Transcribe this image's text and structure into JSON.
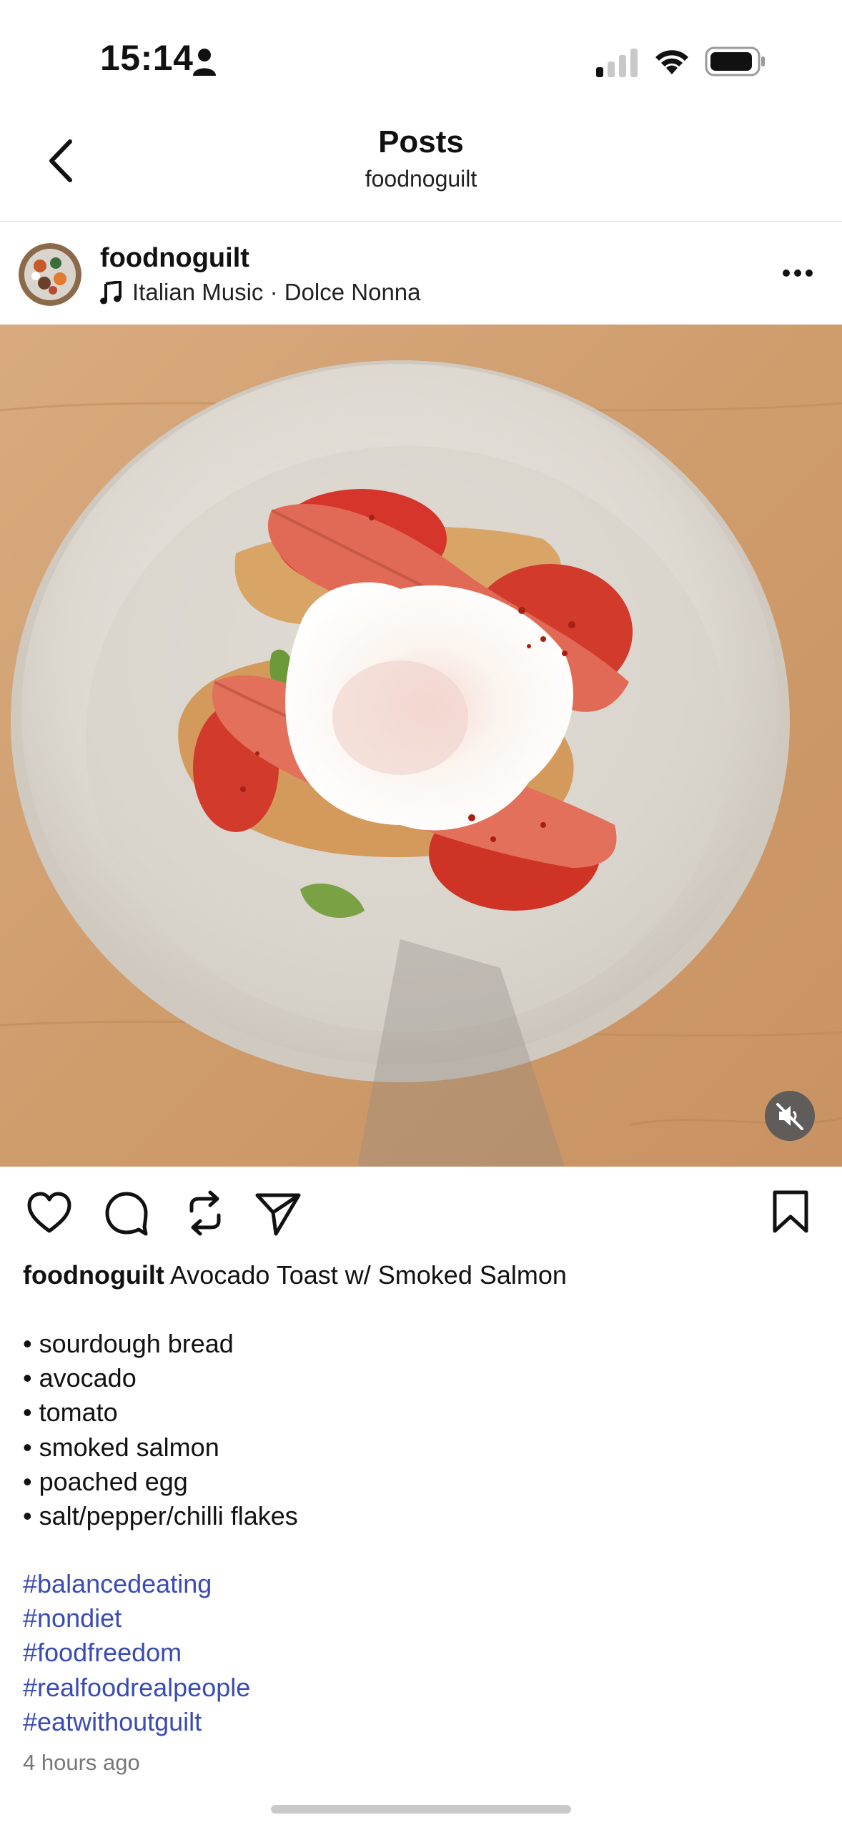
{
  "status_bar": {
    "time": "15:14"
  },
  "header": {
    "title": "Posts",
    "subtitle": "foodnoguilt"
  },
  "post": {
    "username": "foodnoguilt",
    "music": "Italian Music · Dolce Nonna",
    "caption_user": "foodnoguilt",
    "caption_title": "Avocado Toast w/ Smoked Salmon",
    "ingredients": [
      "• sourdough bread",
      "• avocado",
      "• tomato",
      "• smoked salmon",
      "• poached egg",
      "• salt/pepper/chilli flakes"
    ],
    "hashtags": [
      "#balancedeating",
      "#nondiet",
      "#foodfreedom",
      "#realfoodrealpeople",
      "#eatwithoutguilt"
    ],
    "timestamp": "4 hours ago"
  },
  "icons": {
    "back": "chevron-left-icon",
    "music": "music-note-icon",
    "more": "more-horizontal-icon",
    "mute": "speaker-muted-icon",
    "like": "heart-icon",
    "comment": "comment-bubble-icon",
    "repost": "repost-icon",
    "share": "send-icon",
    "save": "bookmark-icon"
  },
  "colors": {
    "hashtag": "#3a4bb5",
    "text": "#111111",
    "muted": "#777777"
  }
}
